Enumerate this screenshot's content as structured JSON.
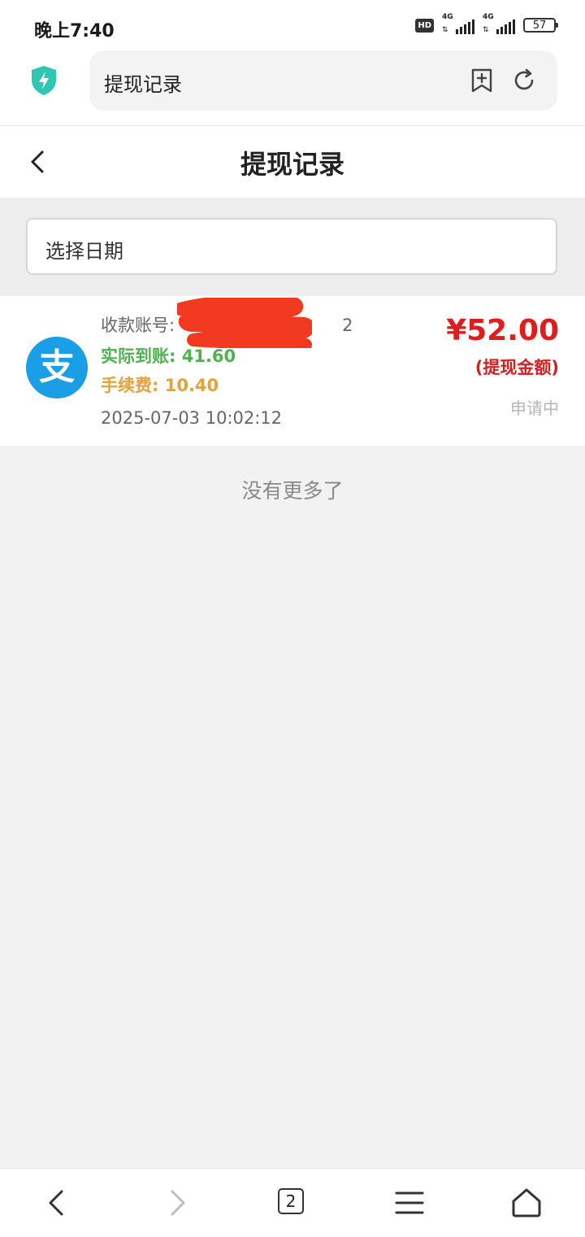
{
  "status_bar": {
    "time": "晚上7:40",
    "hd": "HD",
    "network_1": "4G",
    "network_2": "4G",
    "battery": "57"
  },
  "browser": {
    "url_text": "提现记录",
    "tab_count": "2"
  },
  "page": {
    "title": "提现记录",
    "date_placeholder": "选择日期",
    "no_more": "没有更多了"
  },
  "records": [
    {
      "account_label": "收款账号:",
      "account_value": "2",
      "actual_label": "实际到账:",
      "actual_value": "41.60",
      "fee_label": "手续费:",
      "fee_value": "10.40",
      "time": "2025-07-03 10:02:12",
      "amount": "¥52.00",
      "amount_label": "(提现金额)",
      "status": "申请中",
      "logo_char": "支"
    }
  ],
  "colors": {
    "amount": "#e11c1c",
    "actual": "#4fb24f",
    "fee": "#e3a23a",
    "alipay": "#1a9ee6",
    "shield": "#2fc7b3"
  }
}
